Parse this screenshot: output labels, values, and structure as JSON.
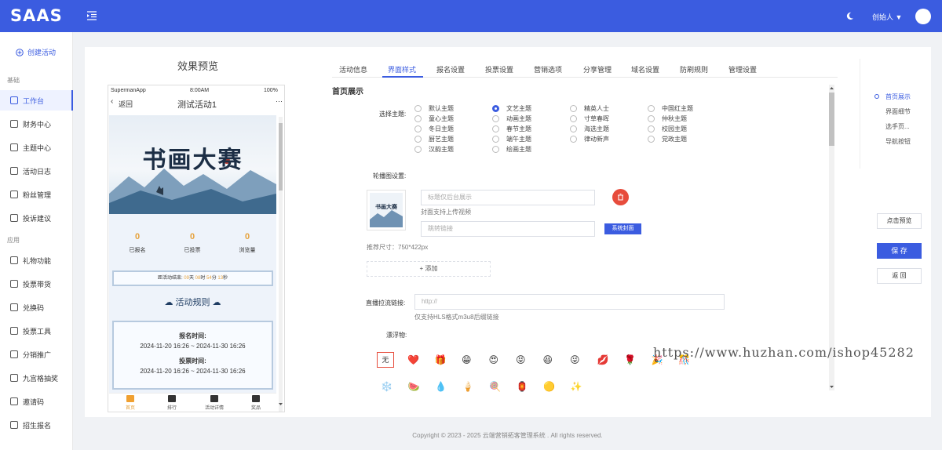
{
  "topbar": {
    "logo": "SAAS",
    "user_name": "创始人 ▼"
  },
  "sidebar": {
    "create_label": "创建活动",
    "group_basic": "基础",
    "group_app": "应用",
    "items": [
      {
        "label": "工作台",
        "icon": "monitor-icon",
        "active": true
      },
      {
        "label": "财务中心",
        "icon": "wallet-icon"
      },
      {
        "label": "主题中心",
        "icon": "theme-icon"
      },
      {
        "label": "活动日志",
        "icon": "edit-icon"
      },
      {
        "label": "粉丝管理",
        "icon": "user-icon"
      },
      {
        "label": "投诉建议",
        "icon": "info-icon"
      },
      {
        "label": "礼物功能",
        "icon": "gift-icon"
      },
      {
        "label": "投票带货",
        "icon": "shop-icon"
      },
      {
        "label": "兑换码",
        "icon": "ticket-icon"
      },
      {
        "label": "投票工具",
        "icon": "tool-icon"
      },
      {
        "label": "分销推广",
        "icon": "share-icon"
      },
      {
        "label": "九宫格抽奖",
        "icon": "grid-icon"
      },
      {
        "label": "邀请码",
        "icon": "key-icon"
      },
      {
        "label": "招生报名",
        "icon": "signup-icon"
      }
    ]
  },
  "preview": {
    "title": "效果预览",
    "status_app": "SupermanApp",
    "status_time": "8:00AM",
    "status_battery": "100%",
    "back_label": "返回",
    "page_title": "测试活动1",
    "more": "···",
    "banner_title": "书画大赛",
    "stats": [
      {
        "value": "0",
        "label": "已报名"
      },
      {
        "value": "0",
        "label": "已投票"
      },
      {
        "value": "0",
        "label": "浏览量"
      }
    ],
    "countdown": {
      "prefix": "距活动结束: ",
      "d": "09",
      "d_unit": "天 ",
      "h": "08",
      "h_unit": "时 ",
      "m": "54",
      "m_unit": "分 ",
      "s": "13",
      "s_unit": "秒"
    },
    "rules_title": "活动规则",
    "signup_label": "报名时间:",
    "signup_range": "2024-11-20 16:26 ~ 2024-11-30 16:26",
    "vote_label": "投票时间:",
    "vote_range": "2024-11-20 16:26 ~ 2024-11-30 16:26",
    "tabbar": [
      {
        "label": "首页",
        "active": true
      },
      {
        "label": "排行"
      },
      {
        "label": "活动详情"
      },
      {
        "label": "奖品"
      }
    ]
  },
  "tabs": [
    "活动信息",
    "界面样式",
    "报名设置",
    "投票设置",
    "营销选项",
    "分享管理",
    "域名设置",
    "防刷规则",
    "管理设置"
  ],
  "active_tab": 1,
  "form": {
    "section_title": "首页展示",
    "theme_label": "选择主题:",
    "themes": [
      [
        "默认主题",
        "童心主题",
        "冬日主题",
        "厨艺主题",
        "汉韵主题"
      ],
      [
        "文艺主题",
        "动画主题",
        "春节主题",
        "端午主题",
        "绘画主题"
      ],
      [
        "精英人士",
        "寸草春晖",
        "海选主题",
        "律动新声"
      ],
      [
        "中国红主题",
        "仲秋主题",
        "校园主题",
        "党政主题"
      ]
    ],
    "selected_theme": "文艺主题",
    "carousel_label": "轮播图设置:",
    "title_placeholder": "标题仅后台展示",
    "video_hint": "封面支持上传视频",
    "link_placeholder": "跳转链接",
    "system_cover_btn": "系统封面",
    "size_hint": "推荐尺寸：750*422px",
    "add_btn": "+ 添加",
    "stream_label": "直播拉流链接:",
    "stream_placeholder": "http://",
    "stream_hint": "仅支持HLS格式m3u8后缀链接",
    "float_label": "漂浮物:",
    "float_none": "无",
    "floats_row1": [
      "❤️",
      "🎁",
      "😁",
      "😍",
      "😝",
      "😆",
      "😜",
      "💋",
      "🌹",
      "🎉",
      "🎊"
    ],
    "floats_row2": [
      "❄️",
      "🍉",
      "💧",
      "🍦",
      "🍭",
      "🏮",
      "🟡",
      "✨"
    ]
  },
  "anchors": [
    "首页展示",
    "界面细节",
    "选手页...",
    "导航按钮"
  ],
  "actions": {
    "preview": "点击预览",
    "save": "保 存",
    "back": "返 回"
  },
  "footer": "Copyright © 2023 - 2025 云端营销拓客管理系统 . All rights reserved.",
  "watermark": "https://www.huzhan.com/ishop45282"
}
